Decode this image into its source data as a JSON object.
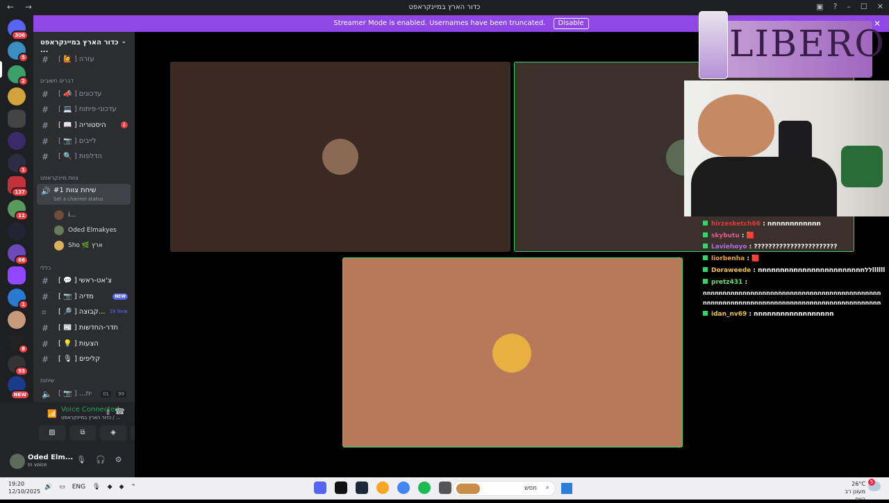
{
  "window": {
    "title": "כדור הארץ במיינקראפט",
    "back": "←",
    "forward": "→"
  },
  "banner": {
    "text": "Streamer Mode is enabled. Usernames have been truncated.",
    "disable_label": "Disable",
    "close": "✕"
  },
  "guilds": [
    {
      "badge": "306"
    },
    {
      "badge": "5"
    },
    {
      "badge": "2"
    },
    {
      "badge": ""
    },
    {
      "badge": ""
    },
    {
      "badge": ""
    },
    {
      "badge": "1"
    },
    {
      "badge": "137"
    },
    {
      "badge": "11"
    },
    {
      "badge": ""
    },
    {
      "badge": "66"
    },
    {
      "badge": ""
    },
    {
      "badge": "1"
    },
    {
      "badge": ""
    },
    {
      "badge": "8"
    },
    {
      "badge": "93"
    },
    {
      "badge": "NEW"
    }
  ],
  "server": {
    "name": "כדור הארץ במיינקראפט ..."
  },
  "channels": {
    "help": {
      "label": "[ 🙋 ] עזרה"
    },
    "cat_important": "דברים חשובים",
    "updates": {
      "label": "[ 📣 ] עדכונים"
    },
    "dev_updates": {
      "label": "[ 💻 ] עדכוני-פיתוח"
    },
    "history": {
      "label": "[ 📖 ] היסטוריה",
      "badge": "2"
    },
    "lives": {
      "label": "[ 📷 ] לייבים"
    },
    "leaks": {
      "label": "[ 🔍 ] הדלפות"
    },
    "cat_team": "צוות מיינקראפט",
    "voice": {
      "label": "שיחת צוות #1",
      "status": "Set a channel status"
    },
    "voice_users": [
      {
        "name": "i..."
      },
      {
        "name": "Oded Elmakyes"
      },
      {
        "name": "Sho 🌿 ארץ"
      }
    ],
    "cat_general": "כללי",
    "main_chat": {
      "label": "[ 💬 ] צ'אט-ראשי"
    },
    "media": {
      "label": "[ 📷 ] מדיה",
      "new": "NEW"
    },
    "group": {
      "label": "[ 🔎 ] קבוצה...",
      "new": "18 New"
    },
    "news": {
      "label": "[ 📰 ] חדר-החדשות"
    },
    "suggestions": {
      "label": "[ 💡 ] הצעות"
    },
    "clips": {
      "label": "[ 🎙 ] קליפים"
    },
    "cat_talks": "שיחות",
    "talk": {
      "label": "[ 📷 ] ...ית",
      "count": "01",
      "limit": "99"
    }
  },
  "voice_panel": {
    "title": "Voice Connected",
    "sub": "כדור הארץ במיינקראפט / ..."
  },
  "user": {
    "name": "Oded Elm...",
    "status": "In voice"
  },
  "overlay": {
    "logo_text": "LIBERO"
  },
  "chat": [
    {
      "user": "hirzesketch66",
      "text": ": nnnnnnnnnnnn",
      "color": "#e23b3b"
    },
    {
      "user": "skybutu",
      "text": ": 🟥",
      "color": "#e25a8a"
    },
    {
      "user": "Laviehoyo",
      "text": ": ???????????????????????",
      "color": "#b16ee6"
    },
    {
      "user": "liorbenha",
      "text": ": 🟥",
      "color": "#e8a23a"
    },
    {
      "user": "Doraweede",
      "text": ": nnnnnnnnnnnnnnnnnnnnnnnnללllllll",
      "color": "#f0c24a"
    },
    {
      "user": "pretz431",
      "text": ":",
      "color": "#68e06b"
    },
    {
      "user": "",
      "text": "nnnnnnnnnnnnnnnnnnnnnnnnnnnnnnnnnnnnnnnnnnnnn",
      "color": "#ffffff"
    },
    {
      "user": "",
      "text": "nnnnnnnnnnnnnnnnnnnnnnnnnnnnnnnnnnnnnnnnnnnnn",
      "color": "#ffffff"
    },
    {
      "user": "idan_nv69",
      "text": ": nnnnnnnnnnnnnnnnnn",
      "color": "#f0c24a"
    }
  ],
  "taskbar": {
    "time": "19:20",
    "date": "12/10/2025",
    "lang": "ENG",
    "search": "חפש",
    "temp": "26°C",
    "weather": "מעונן רב היום",
    "notifications": "5"
  }
}
